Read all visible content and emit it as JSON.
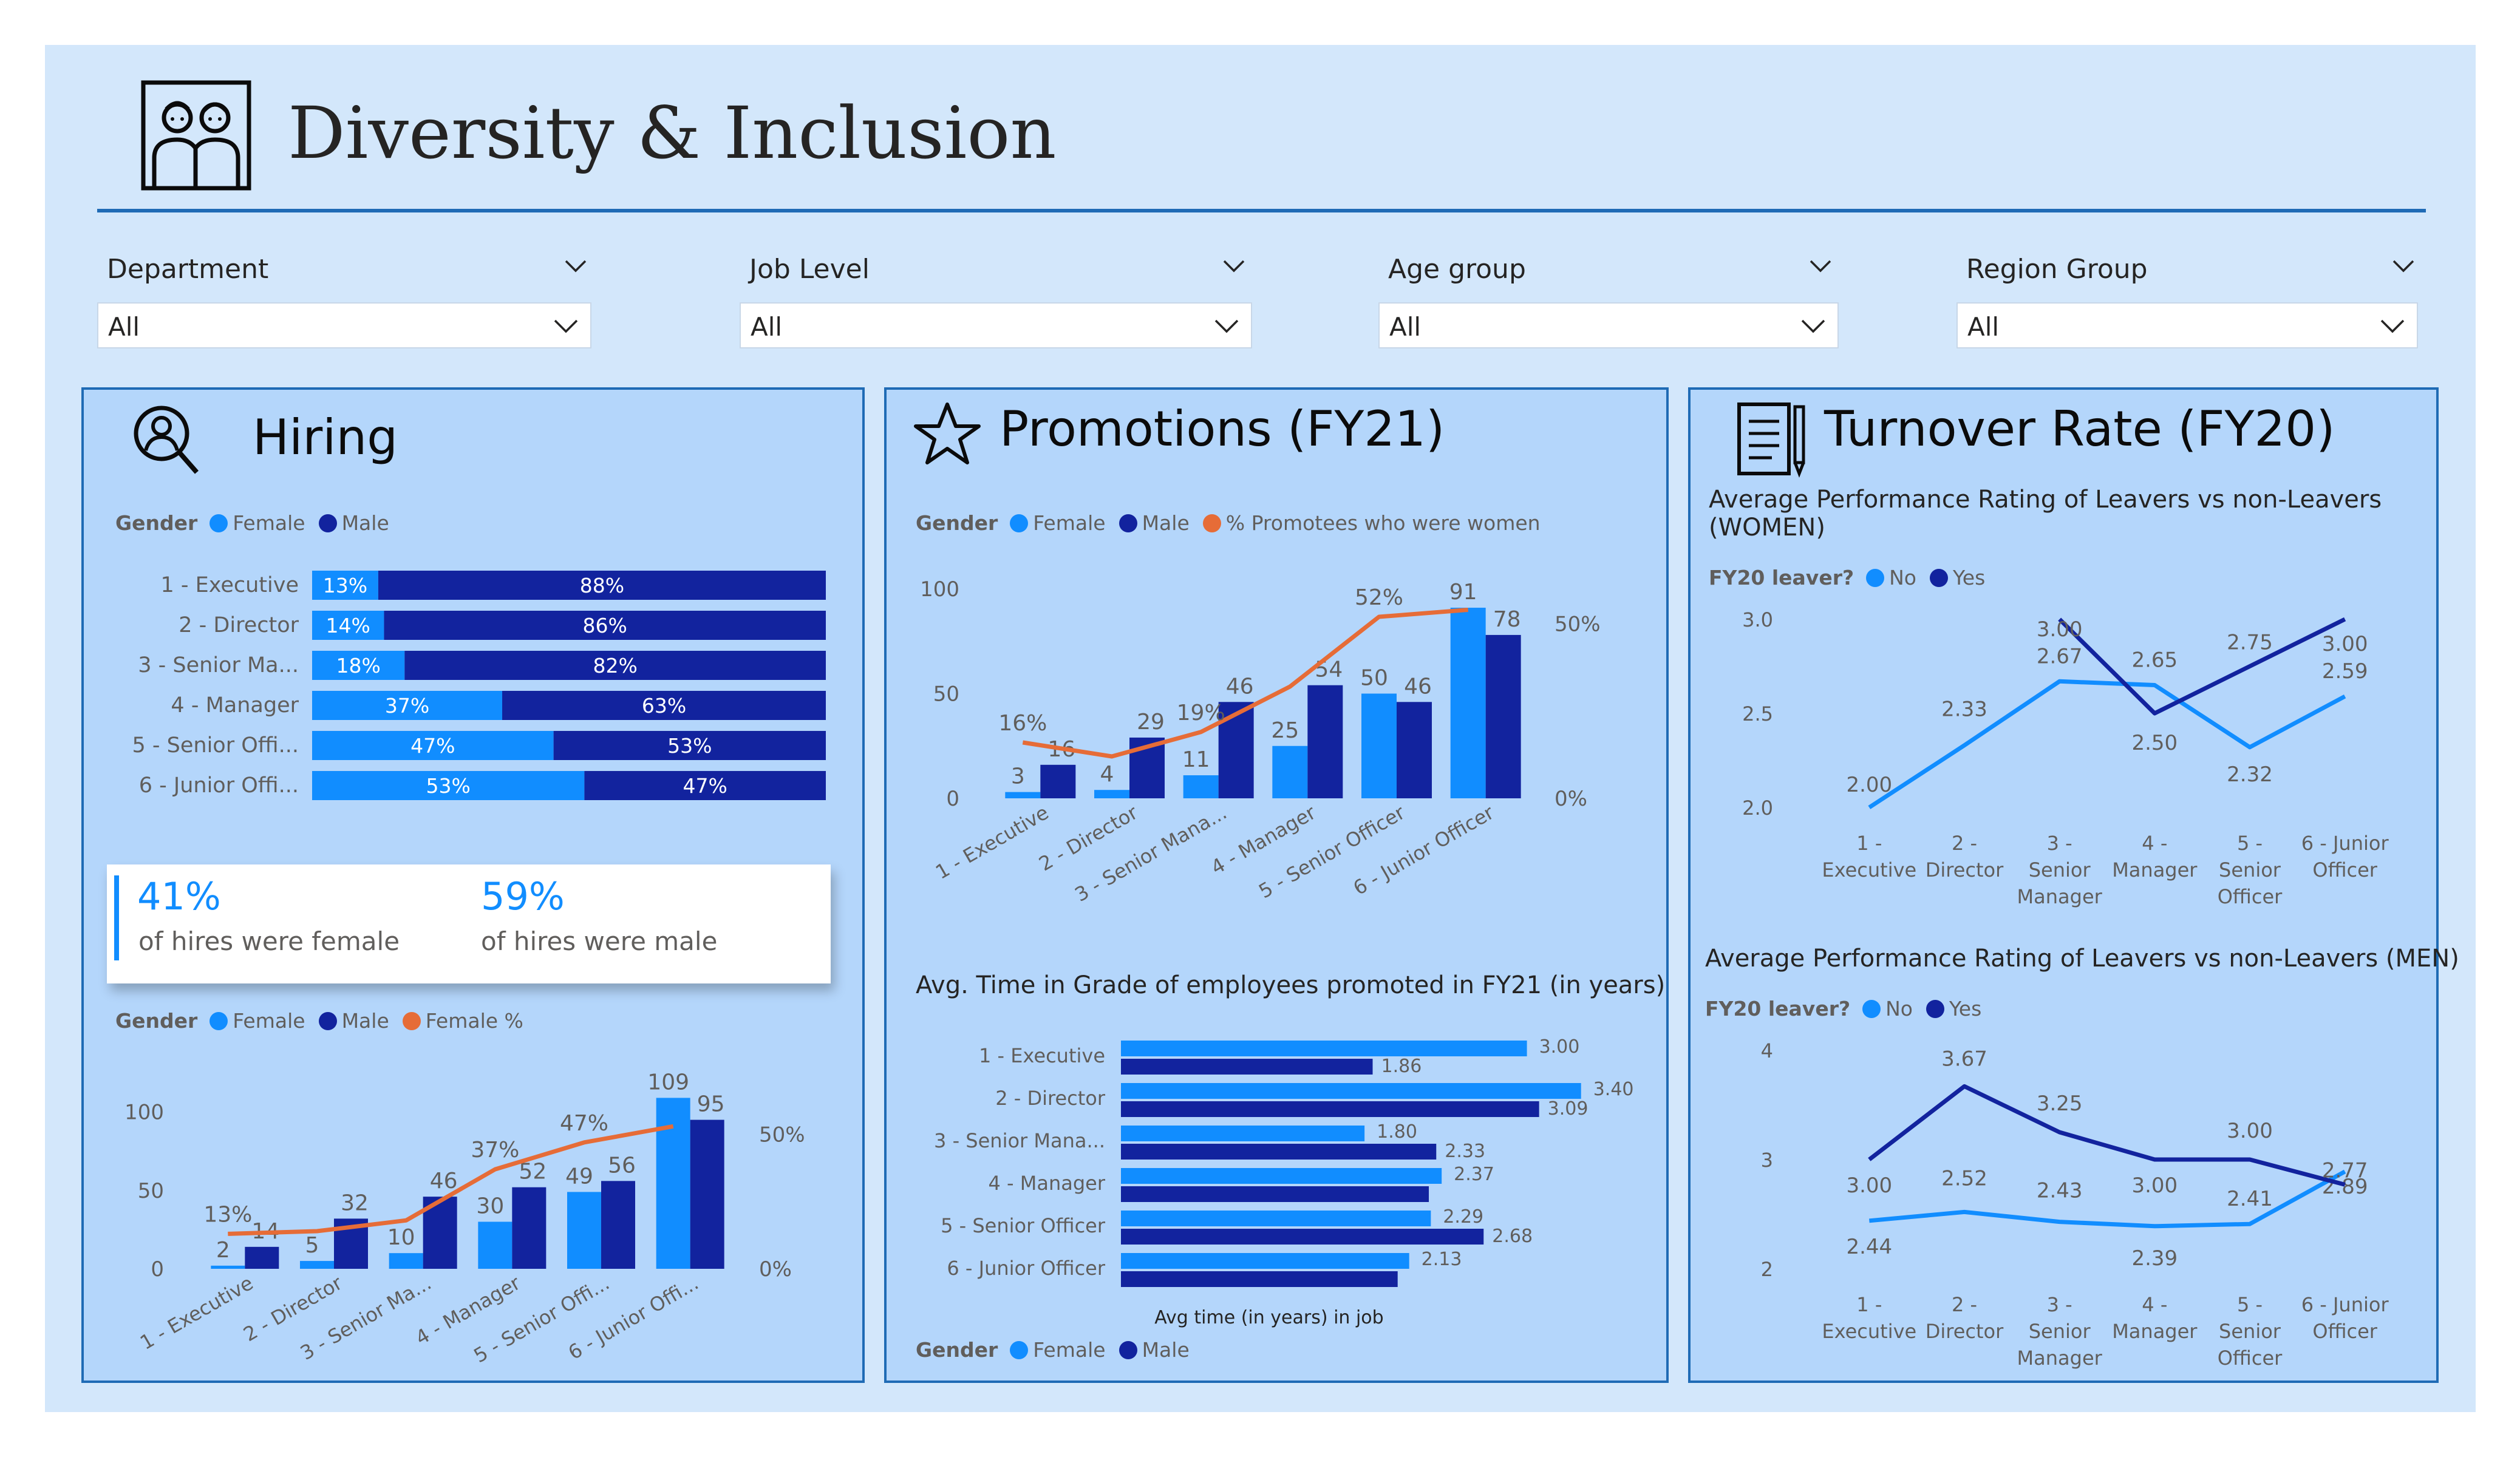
{
  "header": {
    "title": "Diversity & Inclusion",
    "icon": "people-icon"
  },
  "slicers": [
    {
      "title": "Department",
      "value": "All"
    },
    {
      "title": "Job Level",
      "value": "All"
    },
    {
      "title": "Age group",
      "value": "All"
    },
    {
      "title": "Region Group",
      "value": "All"
    }
  ],
  "colors": {
    "female": "#118dff",
    "male": "#12239e",
    "line": "#e66c37",
    "accent": "#1f6bb5"
  },
  "hiring": {
    "title": "Hiring",
    "icon": "magnifier-person-icon",
    "legend_label": "Gender",
    "legend_female": "Female",
    "legend_male": "Male",
    "legend_female_pct": "Female %",
    "kpi_female_value": "41%",
    "kpi_female_label": "of hires were female",
    "kpi_male_value": "59%",
    "kpi_male_label": "of hires were male"
  },
  "promotions": {
    "title": "Promotions (FY21)",
    "icon": "star-icon",
    "legend_label": "Gender",
    "legend_female": "Female",
    "legend_male": "Male",
    "legend_pct": "% Promotees who were women",
    "grade_title": "Avg. Time in Grade of employees promoted in FY21 (in years)",
    "grade_axis": "Avg time (in years) in job"
  },
  "turnover": {
    "title": "Turnover Rate (FY20)",
    "icon": "document-pen-icon",
    "women_title_line1": "Average Performance Rating of Leavers vs non-Leavers",
    "women_title_line2": "(WOMEN)",
    "men_title": "Average Performance Rating of Leavers vs non-Leavers (MEN)",
    "legend_label": "FY20 leaver?",
    "legend_no": "No",
    "legend_yes": "Yes"
  },
  "chart_data": [
    {
      "id": "hiring-by-level",
      "type": "bar",
      "orientation": "horizontal-100%-stacked",
      "categories": [
        "1 - Executive",
        "2 - Director",
        "3 - Senior Ma...",
        "4 - Manager",
        "5 - Senior Offi...",
        "6 - Junior Offi..."
      ],
      "series": [
        {
          "name": "Female",
          "values": [
            13,
            14,
            18,
            37,
            47,
            53
          ],
          "labels": [
            "13%",
            "14%",
            "18%",
            "37%",
            "47%",
            "53%"
          ]
        },
        {
          "name": "Male",
          "values": [
            88,
            86,
            82,
            63,
            53,
            47
          ],
          "labels": [
            "88%",
            "86%",
            "82%",
            "63%",
            "53%",
            "47%"
          ]
        }
      ],
      "legend_title": "Gender"
    },
    {
      "id": "hiring-counts",
      "type": "bar",
      "categories": [
        "1 - Executive",
        "2 - Director",
        "3 - Senior Ma...",
        "4 - Manager",
        "5 - Senior Offi...",
        "6 - Junior Offi..."
      ],
      "series": [
        {
          "name": "Female",
          "values": [
            2,
            5,
            10,
            30,
            49,
            109
          ]
        },
        {
          "name": "Male",
          "values": [
            14,
            32,
            46,
            52,
            56,
            95
          ]
        },
        {
          "name": "Female %",
          "type": "line",
          "values": [
            13,
            14,
            18,
            37,
            47,
            53
          ],
          "labels": [
            "13%",
            "",
            "",
            "37%",
            "47%",
            ""
          ]
        }
      ],
      "ylim": [
        0,
        120
      ],
      "yticks": [
        "0",
        "50",
        "100"
      ],
      "y2ticks": [
        "0%",
        "50%"
      ],
      "legend_title": "Gender"
    },
    {
      "id": "promotions-counts",
      "type": "bar",
      "categories": [
        "1 - Executive",
        "2 - Director",
        "3 - Senior Mana...",
        "4 - Manager",
        "5 - Senior Officer",
        "6 - Junior Officer"
      ],
      "series": [
        {
          "name": "Female",
          "values": [
            3,
            4,
            11,
            25,
            50,
            91
          ]
        },
        {
          "name": "Male",
          "values": [
            16,
            29,
            46,
            54,
            46,
            78
          ]
        },
        {
          "name": "% Promotees who were women",
          "type": "line",
          "values": [
            16,
            12,
            19,
            32,
            52,
            54
          ],
          "labels": [
            "16%",
            "",
            "19%",
            "",
            "52%",
            ""
          ]
        }
      ],
      "ylim": [
        0,
        100
      ],
      "yticks": [
        "0",
        "50",
        "100"
      ],
      "y2ticks": [
        "0%",
        "50%"
      ],
      "legend_title": "Gender"
    },
    {
      "id": "time-in-grade",
      "type": "bar",
      "orientation": "horizontal",
      "categories": [
        "1 - Executive",
        "2 - Director",
        "3 - Senior Mana...",
        "4 - Manager",
        "5 - Senior Officer",
        "6 - Junior Officer"
      ],
      "series": [
        {
          "name": "Female",
          "values": [
            3.0,
            3.4,
            1.8,
            2.37,
            2.29,
            2.13
          ]
        },
        {
          "name": "Male",
          "values": [
            1.86,
            3.09,
            2.33,
            null,
            2.68,
            null
          ]
        }
      ],
      "labels": [
        [
          "3.00",
          "1.86"
        ],
        [
          "3.40",
          "3.09"
        ],
        [
          "1.80",
          "2.33"
        ],
        [
          "2.37",
          ""
        ],
        [
          "2.29",
          "2.68"
        ],
        [
          "2.13",
          ""
        ]
      ],
      "xlabel": "Avg time (in years) in job",
      "legend_title": "Gender"
    },
    {
      "id": "turnover-women",
      "type": "line",
      "categories": [
        "1 - Executive",
        "2 - Director",
        "3 - Senior Manager",
        "4 - Manager",
        "5 - Senior Officer",
        "6 - Junior Officer"
      ],
      "series": [
        {
          "name": "No",
          "values": [
            2.0,
            2.33,
            2.67,
            2.65,
            2.32,
            2.59
          ]
        },
        {
          "name": "Yes",
          "values": [
            null,
            null,
            3.0,
            2.5,
            2.75,
            3.0
          ]
        }
      ],
      "ylim": [
        2.0,
        3.0
      ],
      "yticks": [
        "2.0",
        "2.5",
        "3.0"
      ],
      "legend_title": "FY20 leaver?"
    },
    {
      "id": "turnover-men",
      "type": "line",
      "categories": [
        "1 - Executive",
        "2 - Director",
        "3 - Senior Manager",
        "4 - Manager",
        "5 - Senior Officer",
        "6 - Junior Officer"
      ],
      "series": [
        {
          "name": "No",
          "values": [
            2.44,
            2.52,
            2.43,
            2.39,
            2.41,
            2.89
          ]
        },
        {
          "name": "Yes",
          "values": [
            3.0,
            3.67,
            3.25,
            3.0,
            3.0,
            2.77
          ]
        }
      ],
      "ylim": [
        2,
        4
      ],
      "yticks": [
        "2",
        "3",
        "4"
      ],
      "legend_title": "FY20 leaver?"
    }
  ]
}
